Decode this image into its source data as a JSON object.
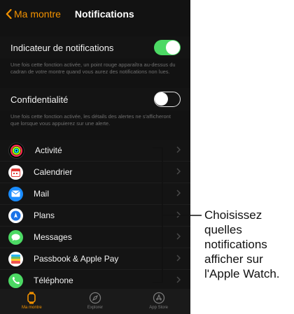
{
  "nav": {
    "back_label": "Ma montre",
    "title": "Notifications"
  },
  "settings": [
    {
      "label": "Indicateur de notifications",
      "state": "on",
      "description": "Une fois cette fonction activée, un point rouge apparaîtra au-dessus du cadran de votre montre quand vous aurez des notifications non lues."
    },
    {
      "label": "Confidentialité",
      "state": "off",
      "description": "Une fois cette fonction activée, les détails des alertes ne s'afficheront que lorsque vous appuierez sur une alerte."
    }
  ],
  "apps": [
    {
      "label": "Activité",
      "icon": "activity-icon",
      "color": "#000000"
    },
    {
      "label": "Calendrier",
      "icon": "calendar-icon",
      "color": "#ffffff"
    },
    {
      "label": "Mail",
      "icon": "mail-icon",
      "color": "#1a8cff"
    },
    {
      "label": "Plans",
      "icon": "maps-icon",
      "color": "#ffffff"
    },
    {
      "label": "Messages",
      "icon": "messages-icon",
      "color": "#4cd964"
    },
    {
      "label": "Passbook & Apple Pay",
      "icon": "passbook-icon",
      "color": "#ffffff"
    },
    {
      "label": "Téléphone",
      "icon": "phone-icon",
      "color": "#4cd964"
    }
  ],
  "tabs": [
    {
      "label": "Ma montre",
      "icon": "watch-icon",
      "active": true
    },
    {
      "label": "Explorer",
      "icon": "compass-icon",
      "active": false
    },
    {
      "label": "App Store",
      "icon": "appstore-icon",
      "active": false
    }
  ],
  "callout": {
    "lines": [
      "Choisissez",
      "quelles",
      "notifications",
      "afficher sur",
      "l'Apple Watch."
    ]
  },
  "colors": {
    "accent": "#f39200",
    "toggle_on": "#4cd964",
    "background": "#121212"
  }
}
